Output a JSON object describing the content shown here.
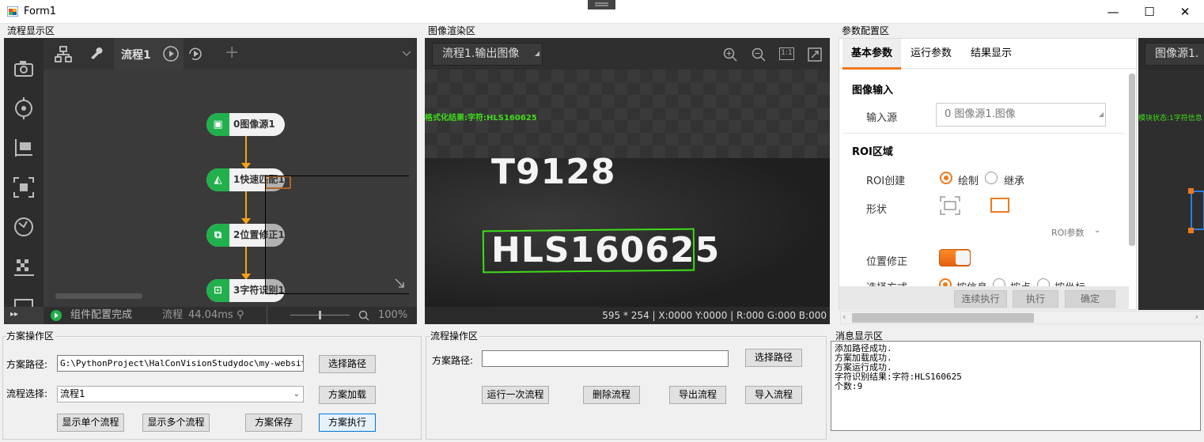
{
  "window": {
    "title": "Form1",
    "min": "—",
    "max": "☐",
    "close": "✕"
  },
  "groups": {
    "flow_display": "流程显示区",
    "image_render": "图像渲染区",
    "param_config": "参数配置区",
    "plan_ops": "方案操作区",
    "flow_ops": "流程操作区",
    "message": "消息显示区"
  },
  "flow": {
    "tab_label": "流程1",
    "nodes": [
      "0图像源1",
      "1快速匹配1",
      "2位置修正1",
      "3字符识别1"
    ],
    "status": "组件配置完成",
    "time_label": "流程",
    "time_value": "44.04ms",
    "zoom": "100%"
  },
  "image": {
    "source_dropdown": "流程1.输出图像",
    "result_overlay": "格式化结果:字符:HLS160625",
    "line1": "T9128",
    "line2": "HLS160625",
    "status_size": "595 * 254",
    "status_xy": "X:0000  Y:0000",
    "status_rgb": "R:000  G:000  B:000"
  },
  "params": {
    "tabs": [
      "基本参数",
      "运行参数",
      "结果显示"
    ],
    "image_input_title": "图像输入",
    "input_source_label": "输入源",
    "input_source_value": "0 图像源1.图像",
    "roi_title": "ROI区域",
    "roi_create_label": "ROI创建",
    "roi_opt_draw": "绘制",
    "roi_opt_inherit": "继承",
    "shape_label": "形状",
    "roi_params_link": "ROI参数",
    "pos_fix_label": "位置修正",
    "select_mode_label": "选择方式",
    "select_opts": [
      "按信息",
      "按点",
      "按坐标"
    ],
    "buttons": [
      "连续执行",
      "执行",
      "确定"
    ]
  },
  "right_preview": {
    "dropdown": "图像源1.",
    "overlay": "模块状态:1字符信息"
  },
  "plan": {
    "path_label": "方案路径:",
    "path_value": "G:\\PythonProject\\HalConVisionStudydoc\\my-website\\do",
    "choose_path": "选择路径",
    "flow_select_label": "流程选择:",
    "flow_select_value": "流程1",
    "load": "方案加载",
    "show_single": "显示单个流程",
    "show_multi": "显示多个流程",
    "save": "方案保存",
    "execute": "方案执行"
  },
  "flowops": {
    "path_label": "方案路径:",
    "path_value": "",
    "choose_path": "选择路径",
    "run_once": "运行一次流程",
    "delete": "删除流程",
    "export": "导出流程",
    "import": "导入流程"
  },
  "messages": [
    "添加路径成功.",
    "方案加载成功.",
    "方案运行成功.",
    "字符识别结果:字符:HLS160625",
    "个数:9"
  ],
  "colors": {
    "accent_orange": "#ee7a1c",
    "node_green": "#21b04b",
    "ocr_green": "#3fdc1a"
  }
}
